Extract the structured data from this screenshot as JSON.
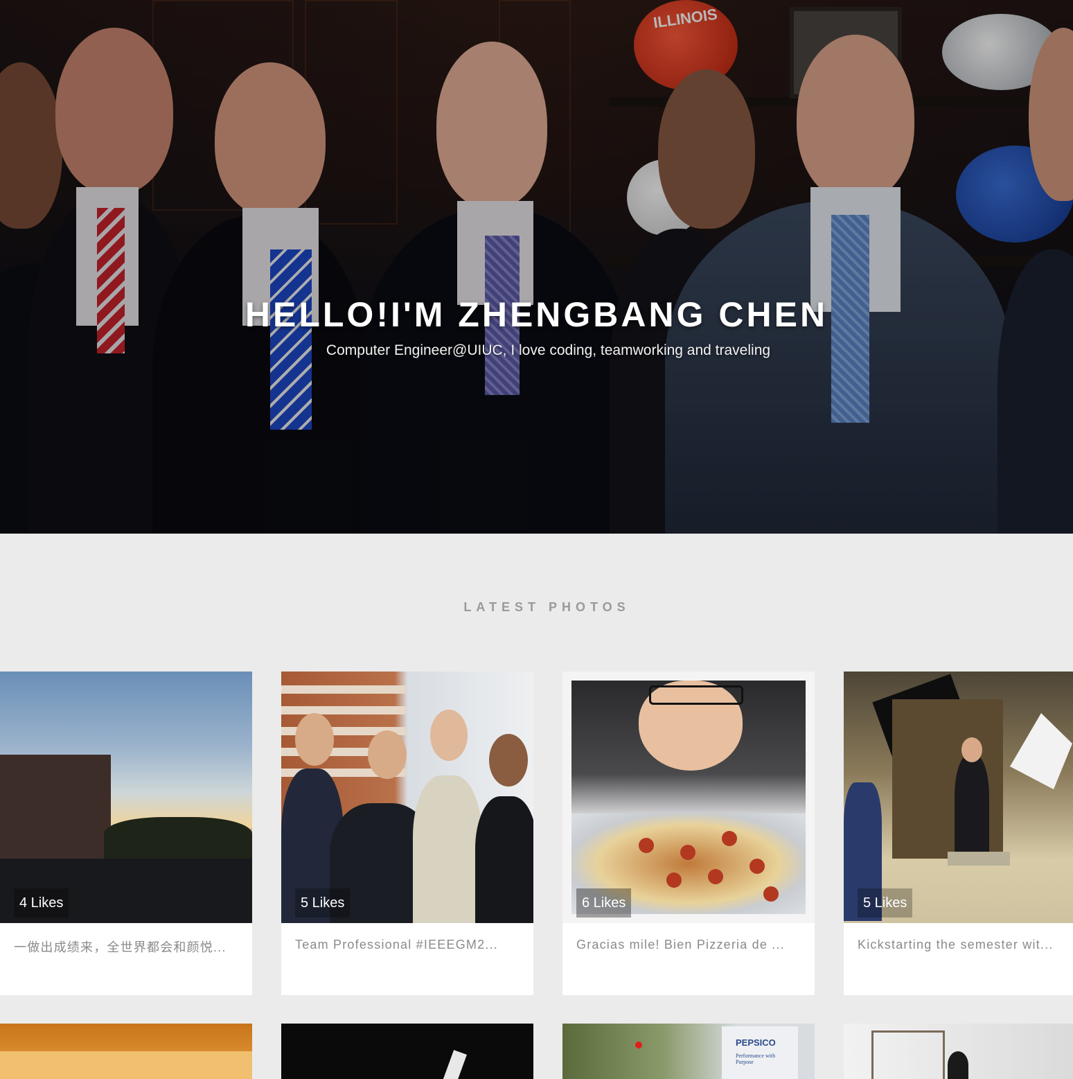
{
  "hero": {
    "title": "HELLO!I'M ZHENGBANG CHEN",
    "subtitle": "Computer Engineer@UIUC, I love coding, teamworking and traveling",
    "helmet_text": "ILLINOIS"
  },
  "section": {
    "title": "LATEST PHOTOS"
  },
  "photos": [
    {
      "likes": "4 Likes",
      "caption": "一做出成绩来，全世界都会和颜悦..."
    },
    {
      "likes": "5 Likes",
      "caption": "Team Professional #IEEEGM2..."
    },
    {
      "likes": "6 Likes",
      "caption": "Gracias mile! Bien Pizzeria de ..."
    },
    {
      "likes": "5 Likes",
      "caption": "Kickstarting the semester wit..."
    }
  ],
  "second_row": {
    "sign_text": "PEPSICO",
    "sign_sub": "Performance with Purpose"
  },
  "colors": {
    "page_bg": "#ebebeb",
    "card_bg": "#ffffff",
    "heading_gray": "#9a9a9a",
    "caption_gray": "#8a8a8a"
  }
}
